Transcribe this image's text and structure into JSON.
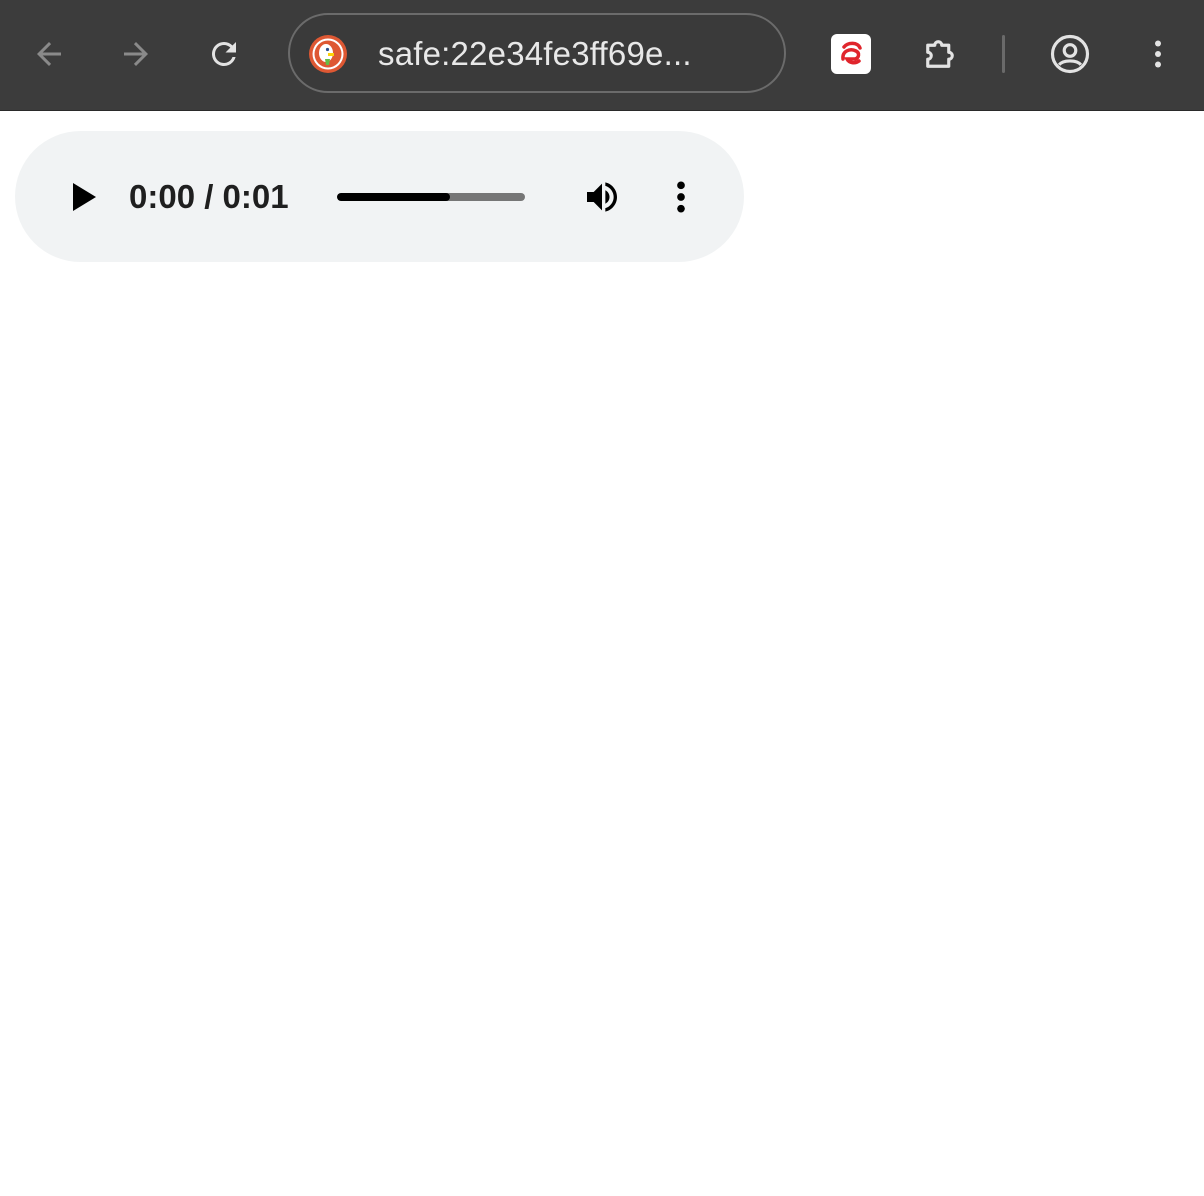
{
  "browser": {
    "address_bar": {
      "url": "safe:22e34fe3ff69e..."
    },
    "toolbar": {
      "back_icon": "arrow-left-icon",
      "forward_icon": "arrow-right-icon",
      "reload_icon": "reload-icon",
      "site_icon": "duckduckgo-icon",
      "extension_icon": "red-extension-icon",
      "extensions_menu_icon": "puzzle-piece-icon",
      "profile_icon": "account-circle-icon",
      "menu_icon": "vertical-ellipsis-icon"
    }
  },
  "audio_player": {
    "time_display": "0:00 / 0:01",
    "timeline_progress": 0.6,
    "play_icon": "play-icon",
    "volume_icon": "volume-up-icon",
    "menu_icon": "vertical-ellipsis-icon"
  },
  "colors": {
    "toolbar_bg": "#3c3c3c",
    "player_bg": "#f1f3f4",
    "extension_red": "#e0252c",
    "duckduckgo_orange": "#de5833"
  }
}
